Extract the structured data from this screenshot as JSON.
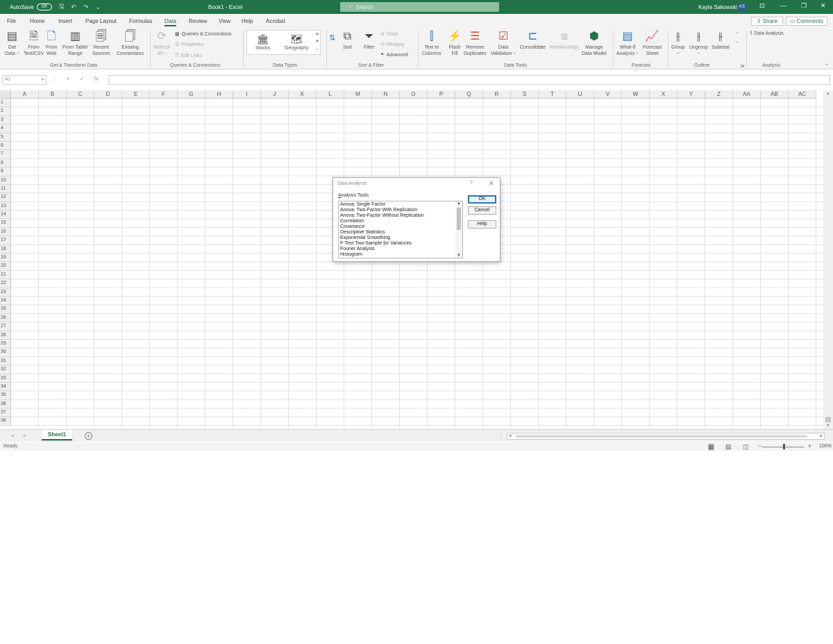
{
  "titlebar": {
    "autosave_label": "AutoSave",
    "autosave_state": "Off",
    "doc_title": "Book1 - Excel",
    "search_placeholder": "Search",
    "user_name": "Kayla Sakowski",
    "user_initials": "KS",
    "bg_color": "#217346"
  },
  "menu": {
    "tabs": [
      "File",
      "Home",
      "Insert",
      "Page Layout",
      "Formulas",
      "Data",
      "Review",
      "View",
      "Help",
      "Acrobat"
    ],
    "active_tab": "Data",
    "share_label": "Share",
    "comments_label": "Comments"
  },
  "ribbon": {
    "get_data": {
      "line1": "Get",
      "line2": "Data ~"
    },
    "from_text": {
      "line1": "From",
      "line2": "Text/CSV"
    },
    "from_web": {
      "line1": "From",
      "line2": "Web"
    },
    "from_table": {
      "line1": "From Table/",
      "line2": "Range"
    },
    "recent_sources": {
      "line1": "Recent",
      "line2": "Sources"
    },
    "existing_conn": {
      "line1": "Existing",
      "line2": "Connections"
    },
    "group_get_transform": "Get & Transform Data",
    "refresh_all": {
      "line1": "Refresh",
      "line2": "All ~"
    },
    "queries_connections": "Queries & Connections",
    "properties": "Properties",
    "edit_links": "Edit Links",
    "group_queries": "Queries & Connections",
    "stocks": "Stocks",
    "geography": "Geography",
    "group_data_types": "Data Types",
    "sort": "Sort",
    "filter": "Filter",
    "clear": "Clear",
    "reapply": "Reapply",
    "advanced": "Advanced",
    "group_sort_filter": "Sort & Filter",
    "text_to_columns": {
      "line1": "Text to",
      "line2": "Columns"
    },
    "flash_fill": {
      "line1": "Flash",
      "line2": "Fill"
    },
    "remove_duplicates": {
      "line1": "Remove",
      "line2": "Duplicates"
    },
    "data_validation": {
      "line1": "Data",
      "line2": "Validation ~"
    },
    "consolidate": "Consolidate",
    "relationships": "Relationships",
    "manage_data_model": {
      "line1": "Manage",
      "line2": "Data Model"
    },
    "group_data_tools": "Data Tools",
    "what_if": {
      "line1": "What-If",
      "line2": "Analysis ~"
    },
    "forecast_sheet": {
      "line1": "Forecast",
      "line2": "Sheet"
    },
    "group_forecast": "Forecast",
    "group_btn": {
      "line1": "Group",
      "line2": "~"
    },
    "ungroup_btn": {
      "line1": "Ungroup",
      "line2": "~"
    },
    "subtotal": "Subtotal",
    "group_outline": "Outline",
    "data_analysis": "Data Analysis",
    "group_analysis": "Analysis"
  },
  "formula_bar": {
    "name_box": "A1",
    "fx": "fx",
    "cancel": "×",
    "enter": "✓"
  },
  "grid": {
    "columns": [
      "A",
      "B",
      "C",
      "D",
      "E",
      "F",
      "G",
      "H",
      "I",
      "J",
      "K",
      "L",
      "M",
      "N",
      "O",
      "P",
      "Q",
      "R",
      "S",
      "T",
      "U",
      "V",
      "W",
      "X",
      "Y",
      "Z",
      "AA",
      "AB",
      "AC"
    ],
    "rows": [
      "1",
      "2",
      "3",
      "4",
      "5",
      "6",
      "7",
      "8",
      "9",
      "10",
      "11",
      "12",
      "13",
      "14",
      "15",
      "16",
      "17",
      "18",
      "19",
      "20",
      "21",
      "22",
      "23",
      "24",
      "25",
      "26",
      "27",
      "28",
      "29",
      "30",
      "31",
      "32",
      "33",
      "34",
      "35",
      "36",
      "37",
      "38"
    ]
  },
  "sheets": {
    "tabs": [
      "Sheet1"
    ],
    "active": "Sheet1"
  },
  "status": {
    "ready": "Ready",
    "zoom": "100%"
  },
  "dialog": {
    "title": "Data Analysis",
    "help_mark": "?",
    "close_mark": "✕",
    "tools_label_first": "A",
    "tools_label_rest": "nalysis Tools",
    "items": [
      "Anova: Single Factor",
      "Anova: Two-Factor With Replication",
      "Anova: Two-Factor Without Replication",
      "Correlation",
      "Covariance",
      "Descriptive Statistics",
      "Exponential Smoothing",
      "F-Test Two-Sample for Variances",
      "Fourier Analysis",
      "Histogram"
    ],
    "ok_label": "OK",
    "cancel_label": "Cancel",
    "help_label": "Help"
  }
}
